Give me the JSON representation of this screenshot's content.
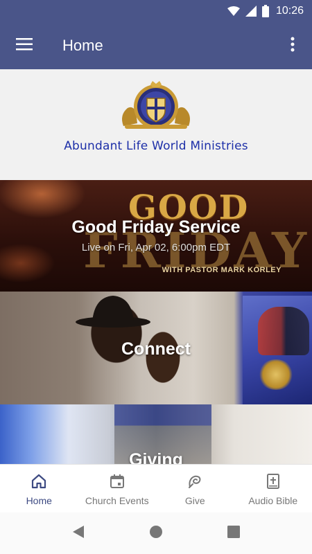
{
  "status_bar": {
    "time": "10:26"
  },
  "app_bar": {
    "title": "Home"
  },
  "banner": {
    "org_name": "Abundant Life World Ministries"
  },
  "tiles": [
    {
      "title": "Good Friday Service",
      "subtitle": "Live on Fri, Apr 02, 6:00pm EDT",
      "art_top": "GOOD",
      "art_bottom": "FRIDAY",
      "art_caption": "WITH PASTOR MARK KORLEY"
    },
    {
      "title": "Connect"
    },
    {
      "title": "Giving"
    }
  ],
  "bottom_nav": [
    {
      "label": "Home",
      "icon": "home-icon",
      "active": true
    },
    {
      "label": "Church Events",
      "icon": "calendar-icon",
      "active": false
    },
    {
      "label": "Give",
      "icon": "give-icon",
      "active": false
    },
    {
      "label": "Audio Bible",
      "icon": "bible-icon",
      "active": false
    }
  ],
  "colors": {
    "primary": "#4a5589",
    "active_nav": "#3d4a82",
    "inactive_nav": "#777777",
    "org_text": "#1d2fa8"
  }
}
